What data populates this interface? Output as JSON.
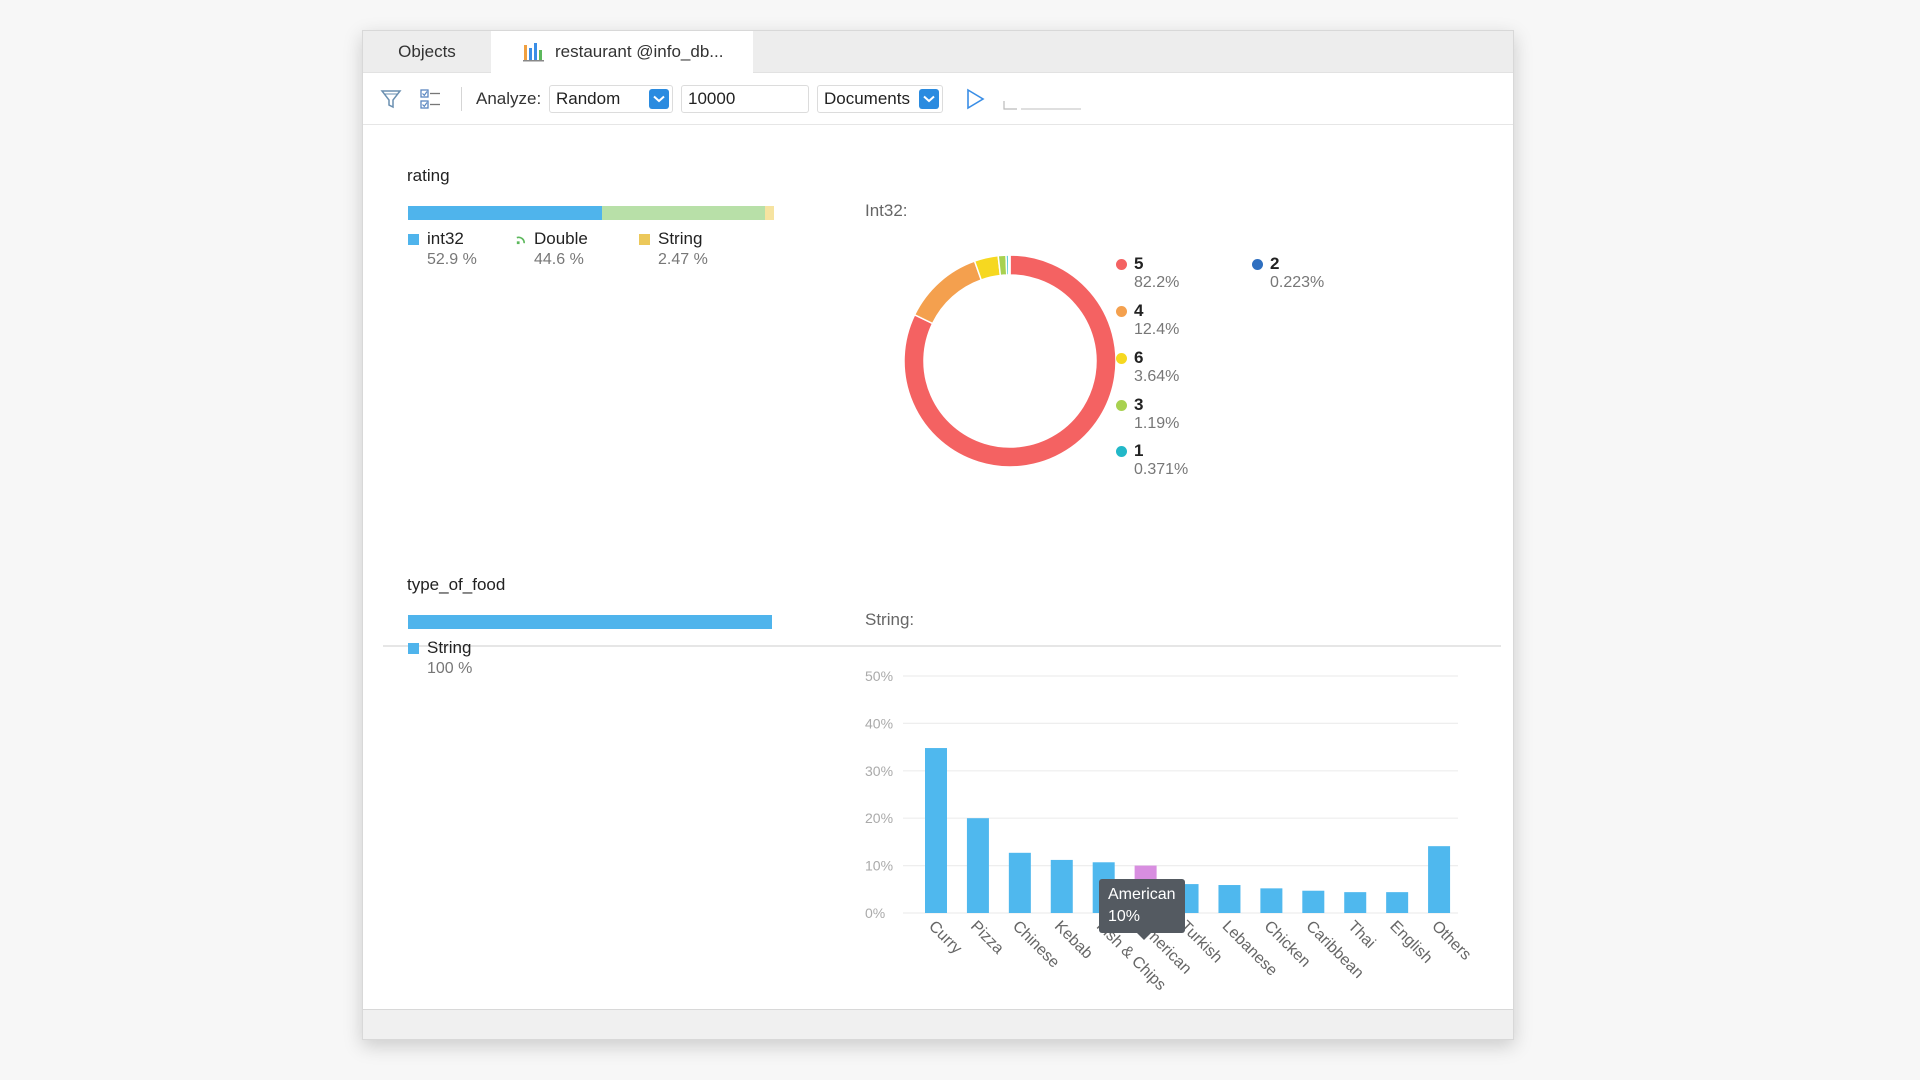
{
  "tabs": [
    {
      "label": "Objects",
      "active": false
    },
    {
      "label": "restaurant @info_db...",
      "active": true,
      "icon": "bar-chart-icon"
    }
  ],
  "toolbar": {
    "filter_icon": "filter-icon",
    "fields_icon": "checklist-icon",
    "analyze_label": "Analyze:",
    "method_value": "Random",
    "sample_size_value": "10000",
    "scope_value": "Documents",
    "run_icon": "play-icon"
  },
  "fields": [
    {
      "name": "rating",
      "types": [
        {
          "name": "int32",
          "percent_label": "52.9 %",
          "percent": 52.9,
          "color": "#4fb4ec",
          "icon": "square"
        },
        {
          "name": "Double",
          "percent_label": "44.6 %",
          "percent": 44.6,
          "color": "#b8e0a8",
          "icon": "double-icon"
        },
        {
          "name": "String",
          "percent_label": "2.47 %",
          "percent": 2.47,
          "color": "#f6e3a0",
          "icon": "square"
        }
      ],
      "chart_title": "Int32:"
    },
    {
      "name": "type_of_food",
      "types": [
        {
          "name": "String",
          "percent_label": "100 %",
          "percent": 100,
          "color": "#4fb4ec",
          "icon": "square"
        }
      ],
      "chart_title": "String:"
    }
  ],
  "tooltip": {
    "label": "American",
    "value": "10%"
  },
  "chart_data": [
    {
      "type": "pie",
      "title": "Int32:",
      "donut": true,
      "slices": [
        {
          "label": "5",
          "value": 82.2,
          "value_label": "82.2%",
          "color": "#f46262"
        },
        {
          "label": "4",
          "value": 12.4,
          "value_label": "12.4%",
          "color": "#f4a04e"
        },
        {
          "label": "6",
          "value": 3.64,
          "value_label": "3.64%",
          "color": "#f6d820"
        },
        {
          "label": "3",
          "value": 1.19,
          "value_label": "1.19%",
          "color": "#a8d150"
        },
        {
          "label": "1",
          "value": 0.371,
          "value_label": "0.371%",
          "color": "#22b8c8"
        },
        {
          "label": "2",
          "value": 0.223,
          "value_label": "0.223%",
          "color": "#2e6fc0"
        }
      ],
      "legend_placement": "right"
    },
    {
      "type": "bar",
      "title": "String:",
      "categories": [
        "Curry",
        "Pizza",
        "Chinese",
        "Kebab",
        "Fish & Chips",
        "American",
        "Turkish",
        "Lebanese",
        "Chicken",
        "Caribbean",
        "Thai",
        "English",
        "Others"
      ],
      "values": [
        34.8,
        20.0,
        12.7,
        11.2,
        10.7,
        10.0,
        6.1,
        5.9,
        5.2,
        4.7,
        4.4,
        4.4,
        14.1
      ],
      "highlighted": "American",
      "bar_color": "#4fb8ee",
      "highlight_color": "#d88ee0",
      "ylim": [
        0,
        50
      ],
      "yticks": [
        "0%",
        "10%",
        "20%",
        "30%",
        "40%",
        "50%"
      ],
      "grid": true,
      "xlabel": "",
      "ylabel": ""
    }
  ]
}
